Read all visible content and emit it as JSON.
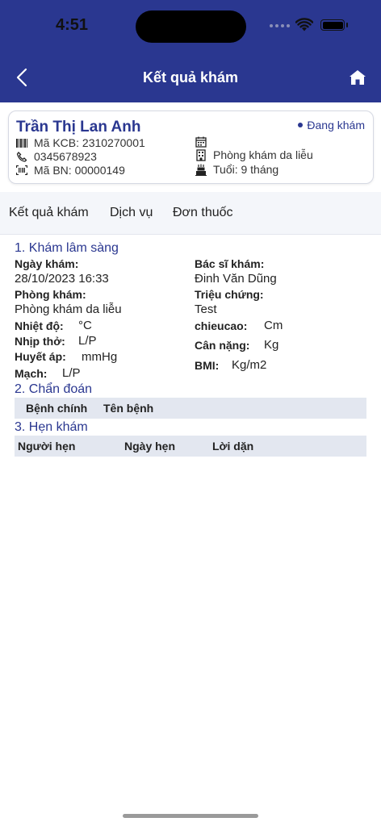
{
  "status_bar": {
    "time": "4:51"
  },
  "header": {
    "title": "Kết quả khám"
  },
  "patient": {
    "name": "Trần Thị Lan Anh",
    "status": "Đang khám",
    "kcb_code": "Mã KCB: 2310270001",
    "phone": "0345678923",
    "bn_code": "Mã BN: 00000149",
    "clinic": "Phòng khám da liễu",
    "age": "Tuổi: 9 tháng"
  },
  "tabs": [
    {
      "label": "Kết quả khám"
    },
    {
      "label": "Dịch vụ"
    },
    {
      "label": "Đơn thuốc"
    }
  ],
  "clinical": {
    "title": "1. Khám lâm sàng",
    "exam_date_label": "Ngày khám:",
    "exam_date": "28/10/2023 16:33",
    "doctor_label": "Bác sĩ khám:",
    "doctor": "Đinh Văn Dũng",
    "room_label": "Phòng khám:",
    "room": "Phòng khám da liễu",
    "symptom_label": "Triệu chứng:",
    "symptom": "Test",
    "temp_label": "Nhiệt độ:",
    "temp_unit": "°C",
    "height_label": "chieucao:",
    "height_unit": "Cm",
    "breath_label": "Nhịp thở:",
    "breath_unit": "L/P",
    "weight_label": "Cân nặng:",
    "weight_unit": "Kg",
    "bp_label": "Huyết áp:",
    "bp_unit": "mmHg",
    "bmi_label": "BMI:",
    "bmi_unit": "Kg/m2",
    "pulse_label": "Mạch:",
    "pulse_unit": "L/P"
  },
  "diagnosis": {
    "title": "2. Chẩn đoán",
    "columns": [
      "Bệnh chính",
      "Tên bệnh"
    ]
  },
  "appointment": {
    "title": "3. Hẹn khám",
    "columns": [
      "Người hẹn",
      "Ngày hẹn",
      "Lời dặn"
    ]
  },
  "colors": {
    "primary": "#2a3790",
    "table_header": "#e3e7f0"
  }
}
